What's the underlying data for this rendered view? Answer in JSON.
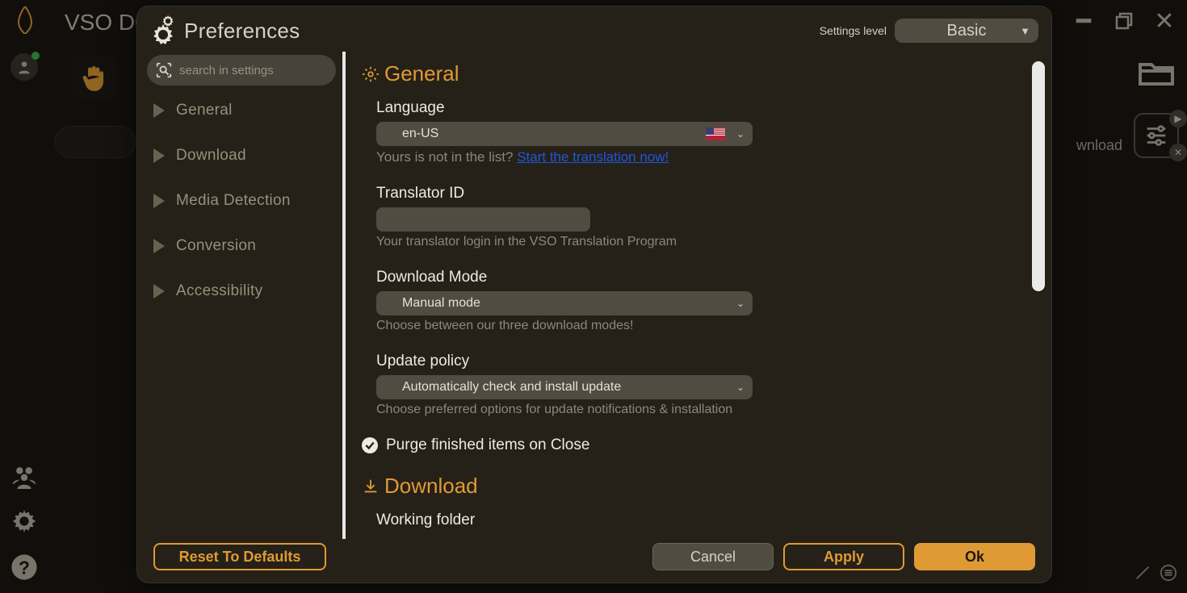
{
  "app": {
    "title": "VSO DO"
  },
  "bg": {
    "download_label": "wnload"
  },
  "dialog": {
    "title": "Preferences",
    "level_label": "Settings level",
    "level_value": "Basic",
    "search_placeholder": "search in settings",
    "nav": {
      "general": "General",
      "download": "Download",
      "media": "Media Detection",
      "conversion": "Conversion",
      "accessibility": "Accessibility"
    },
    "general": {
      "heading": "General",
      "language_label": "Language",
      "language_value": "en-US",
      "language_hint_prefix": "Yours is not in the list?",
      "language_link": "Start the translation now!",
      "translator_label": "Translator ID",
      "translator_value": "",
      "translator_desc": "Your translator login in the VSO Translation Program",
      "dlmode_label": "Download Mode",
      "dlmode_value": "Manual mode",
      "dlmode_desc": "Choose between our three download modes!",
      "update_label": "Update policy",
      "update_value": "Automatically check and install update",
      "update_desc": "Choose preferred options for update notifications & installation",
      "purge_label": "Purge finished items on Close"
    },
    "download": {
      "heading": "Download",
      "working_folder_label": "Working folder"
    },
    "footer": {
      "reset": "Reset To Defaults",
      "cancel": "Cancel",
      "apply": "Apply",
      "ok": "Ok"
    }
  }
}
